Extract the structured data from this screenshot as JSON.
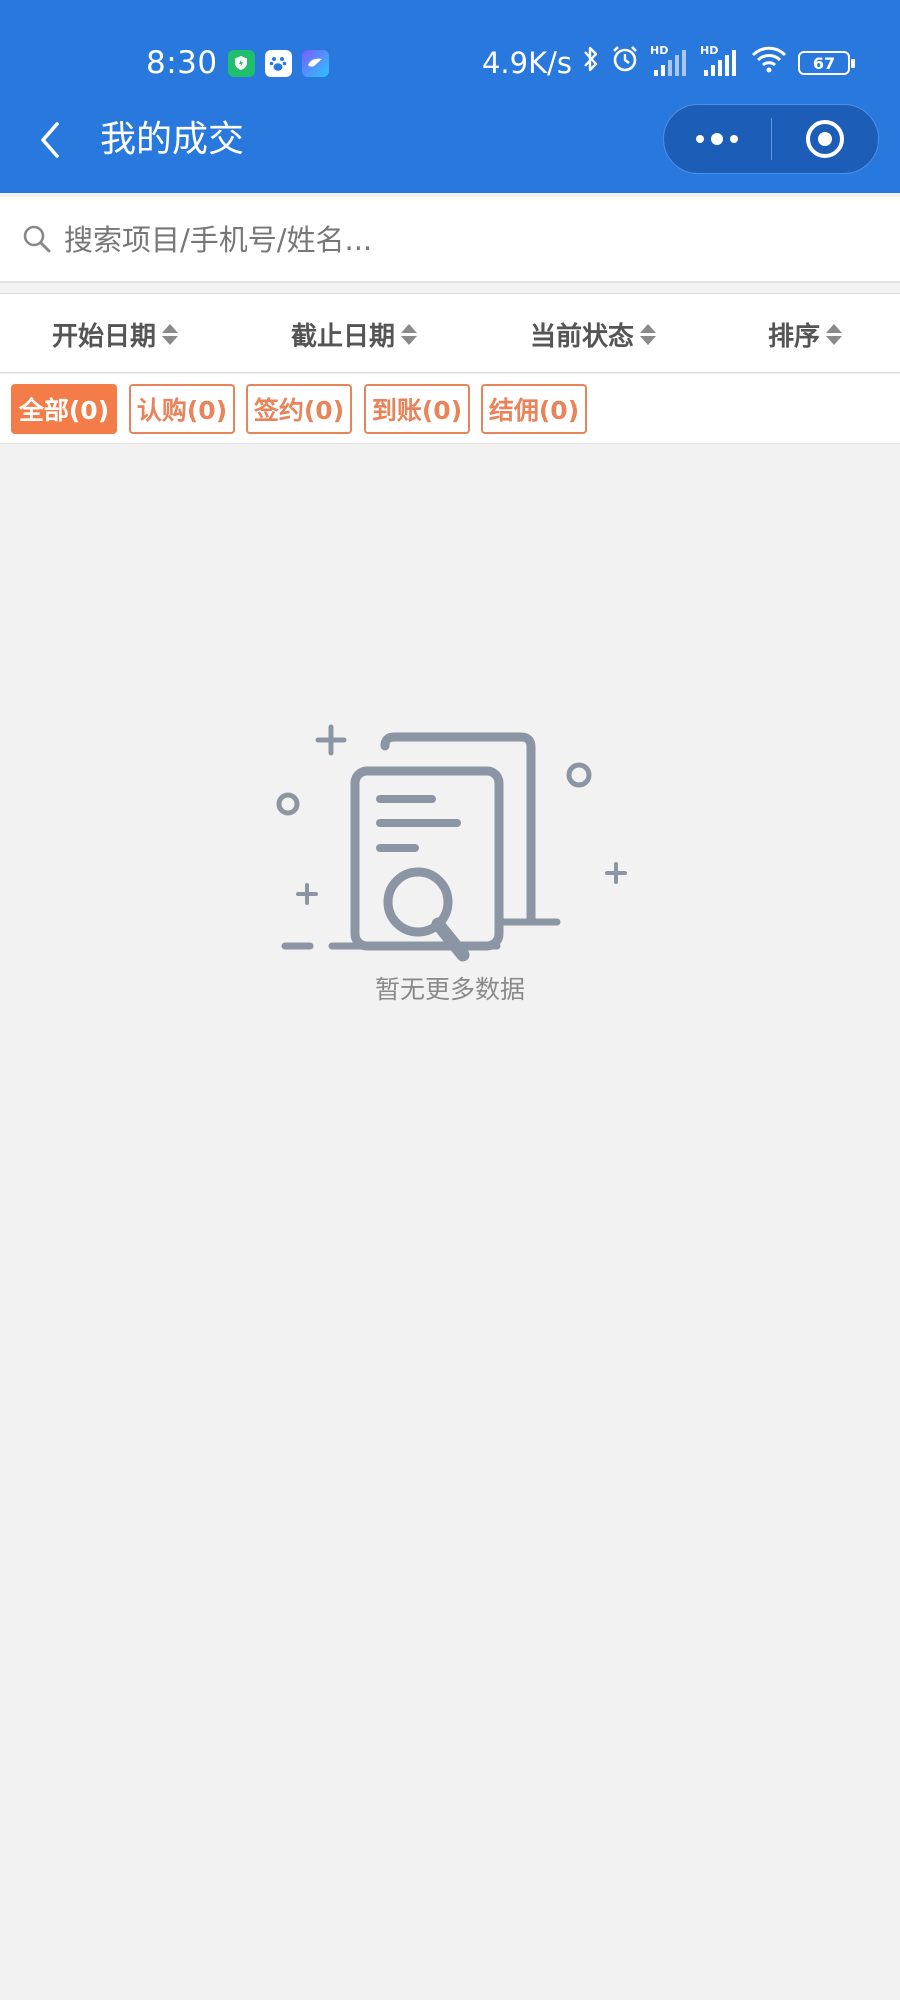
{
  "status_bar": {
    "time": "8:30",
    "network_speed": "4.9K/s",
    "battery": "67",
    "hd1": "HD",
    "hd2": "HD"
  },
  "nav": {
    "title": "我的成交",
    "back_icon": "chevron-left-icon",
    "more_icon": "more-dots-icon",
    "close_icon": "target-icon"
  },
  "search": {
    "placeholder": "搜索项目/手机号/姓名...",
    "value": ""
  },
  "filters": [
    {
      "label": "开始日期"
    },
    {
      "label": "截止日期"
    },
    {
      "label": "当前状态"
    },
    {
      "label": "排序"
    }
  ],
  "tabs": [
    {
      "label": "全部(0)",
      "active": true
    },
    {
      "label": "认购(0)",
      "active": false
    },
    {
      "label": "签约(0)",
      "active": false
    },
    {
      "label": "到账(0)",
      "active": false
    },
    {
      "label": "结佣(0)",
      "active": false
    }
  ],
  "empty_state": {
    "message": "暂无更多数据",
    "icon": "empty-document-search-icon"
  },
  "colors": {
    "header": "#2878de",
    "accent": "#f47c48",
    "tag_border": "#e8835a",
    "background": "#f2f2f2",
    "illustration": "#8c95a3"
  }
}
